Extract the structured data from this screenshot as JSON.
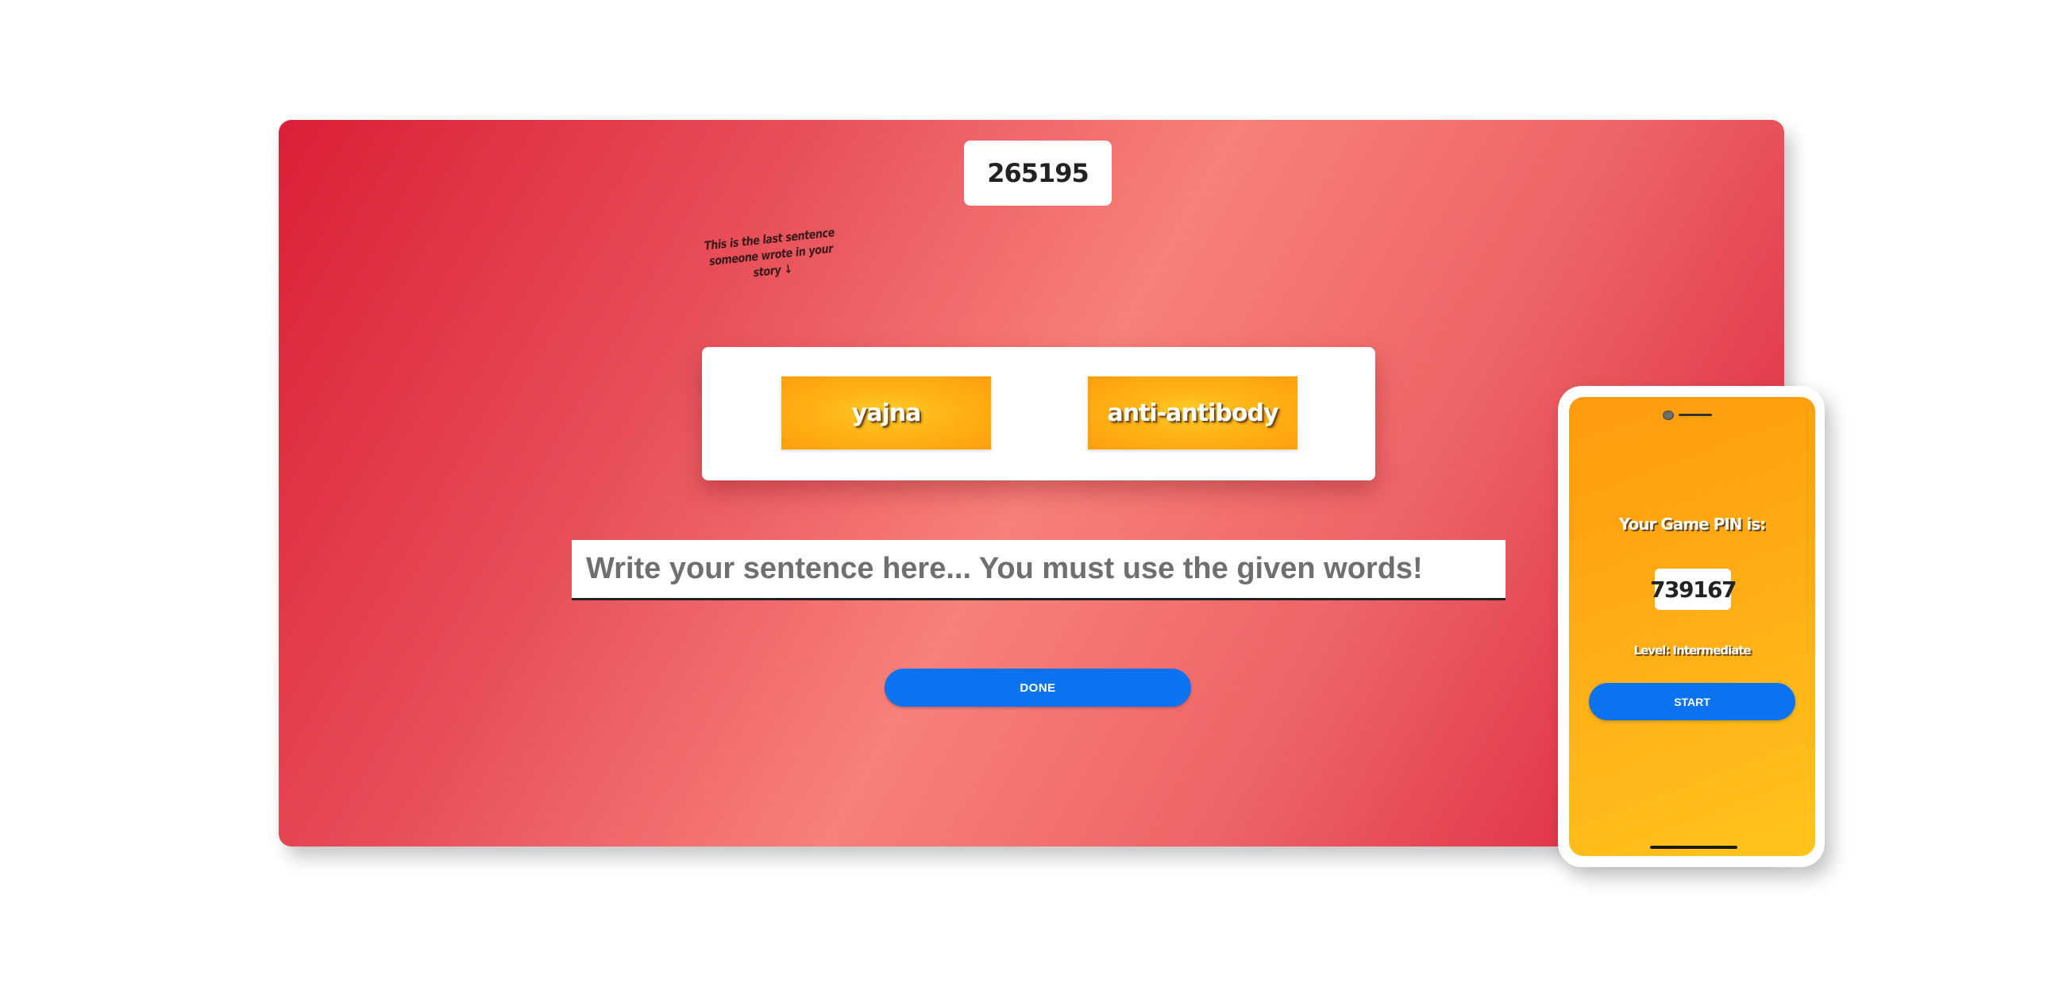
{
  "board": {
    "pin": "265195",
    "last_sentence_note": "This is the last sentence someone wrote in your story ↓",
    "words": [
      "yajna",
      "anti-antibody"
    ],
    "sentence_placeholder": "Write your sentence here... You must use the given words!",
    "done_label": "DONE"
  },
  "phone": {
    "pin_label": "Your Game PIN is:",
    "pin": "739167",
    "level": "Level: Intermediate",
    "start_label": "START"
  },
  "colors": {
    "board_gradient": [
      "#dc1f36",
      "#f78079",
      "#dc2a40"
    ],
    "word_chip": "#ffb516",
    "button": "#0b72f0",
    "phone_screen": "#ffae15"
  }
}
